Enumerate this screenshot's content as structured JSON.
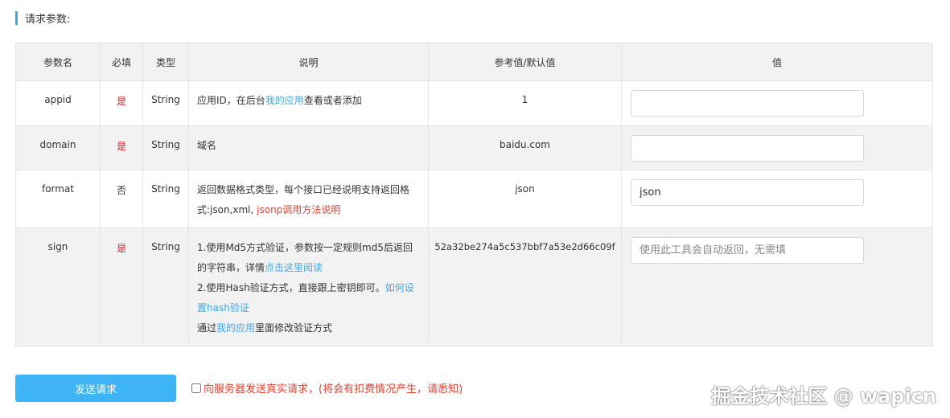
{
  "section_title": "请求参数:",
  "headers": [
    "参数名",
    "必填",
    "类型",
    "说明",
    "参考值/默认值",
    "值"
  ],
  "rows": [
    {
      "name": "appid",
      "required": "是",
      "type": "String",
      "desc_prefix": "应用ID，在后台",
      "desc_link": "我的应用",
      "desc_suffix": "查看或者添加",
      "reference": "1",
      "value": "",
      "placeholder": ""
    },
    {
      "name": "domain",
      "required": "是",
      "type": "String",
      "desc": "域名",
      "reference": "baidu.com",
      "value": "",
      "placeholder": ""
    },
    {
      "name": "format",
      "required": "否",
      "type": "String",
      "desc_prefix": "返回数据格式类型，每个接口已经说明支持返回格式:json,xml, ",
      "desc_link": "jsonp调用方法说明",
      "reference": "json",
      "value": "json",
      "placeholder": ""
    },
    {
      "name": "sign",
      "required": "是",
      "type": "String",
      "desc_line1": "1.使用Md5方式验证，参数按一定规则md5后返回的字符串，详情",
      "desc_link1": "点击这里阅读",
      "desc_line2": "2.使用Hash验证方式，直接跟上密钥即可。",
      "desc_link2": "如何设置hash验证",
      "desc_line3_prefix": "通过",
      "desc_link3": "我的应用",
      "desc_line3_suffix": "里面修改验证方式",
      "reference": "52a32be274a5c537bbf7a53e2d66c09f",
      "value": "",
      "placeholder": "使用此工具会自动返回，无需填"
    }
  ],
  "send_button": "发送请求",
  "real_request_label": "向服务器发送真实请求，(将会有扣费情况产生，请悉知)",
  "watermark": "掘金技术社区 @ wapicn",
  "colors": {
    "accent": "#3ba6e8",
    "button": "#3eb4f5",
    "required": "#d9242a",
    "warning": "#e8402f",
    "header_bg": "#f2f2f2"
  }
}
